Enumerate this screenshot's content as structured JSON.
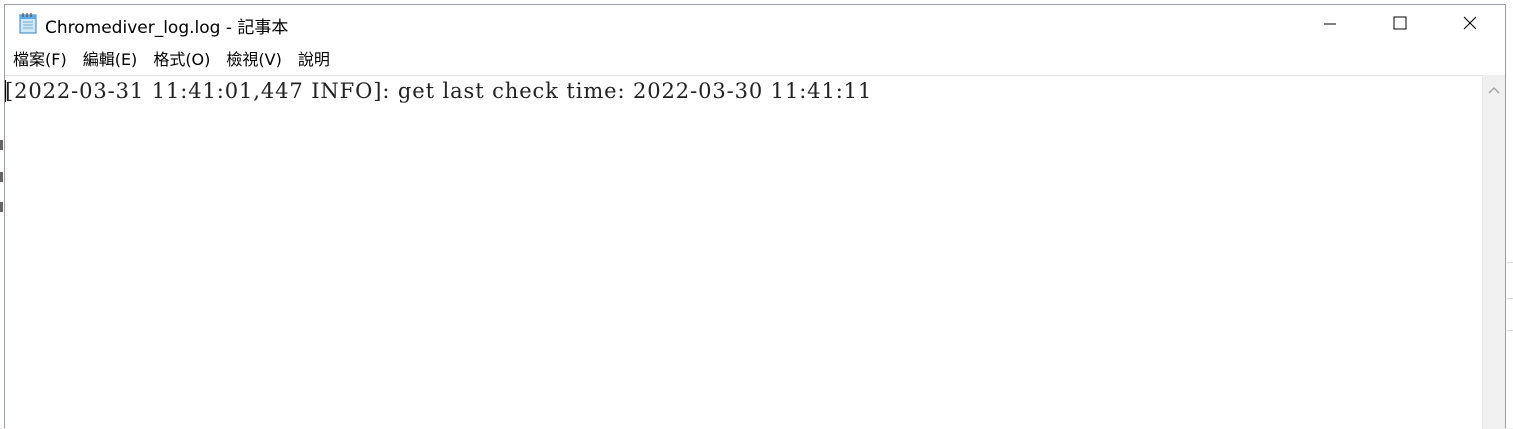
{
  "window": {
    "title": "Chromediver_log.log - 記事本",
    "icon": "notepad-icon",
    "controls": {
      "minimize_icon": "minimize-icon",
      "maximize_icon": "maximize-icon",
      "close_icon": "close-icon"
    }
  },
  "menu": {
    "items": [
      {
        "label": "檔案(F)"
      },
      {
        "label": "編輯(E)"
      },
      {
        "label": "格式(O)"
      },
      {
        "label": "檢視(V)"
      },
      {
        "label": "說明"
      }
    ]
  },
  "editor": {
    "content": "[2022-03-31 11:41:01,447 INFO]: get last check time: 2022-03-30 11:41:11"
  },
  "colors": {
    "window_border": "#9aa0a6",
    "text": "#222222",
    "scrollbar": "#f0f0f0"
  }
}
